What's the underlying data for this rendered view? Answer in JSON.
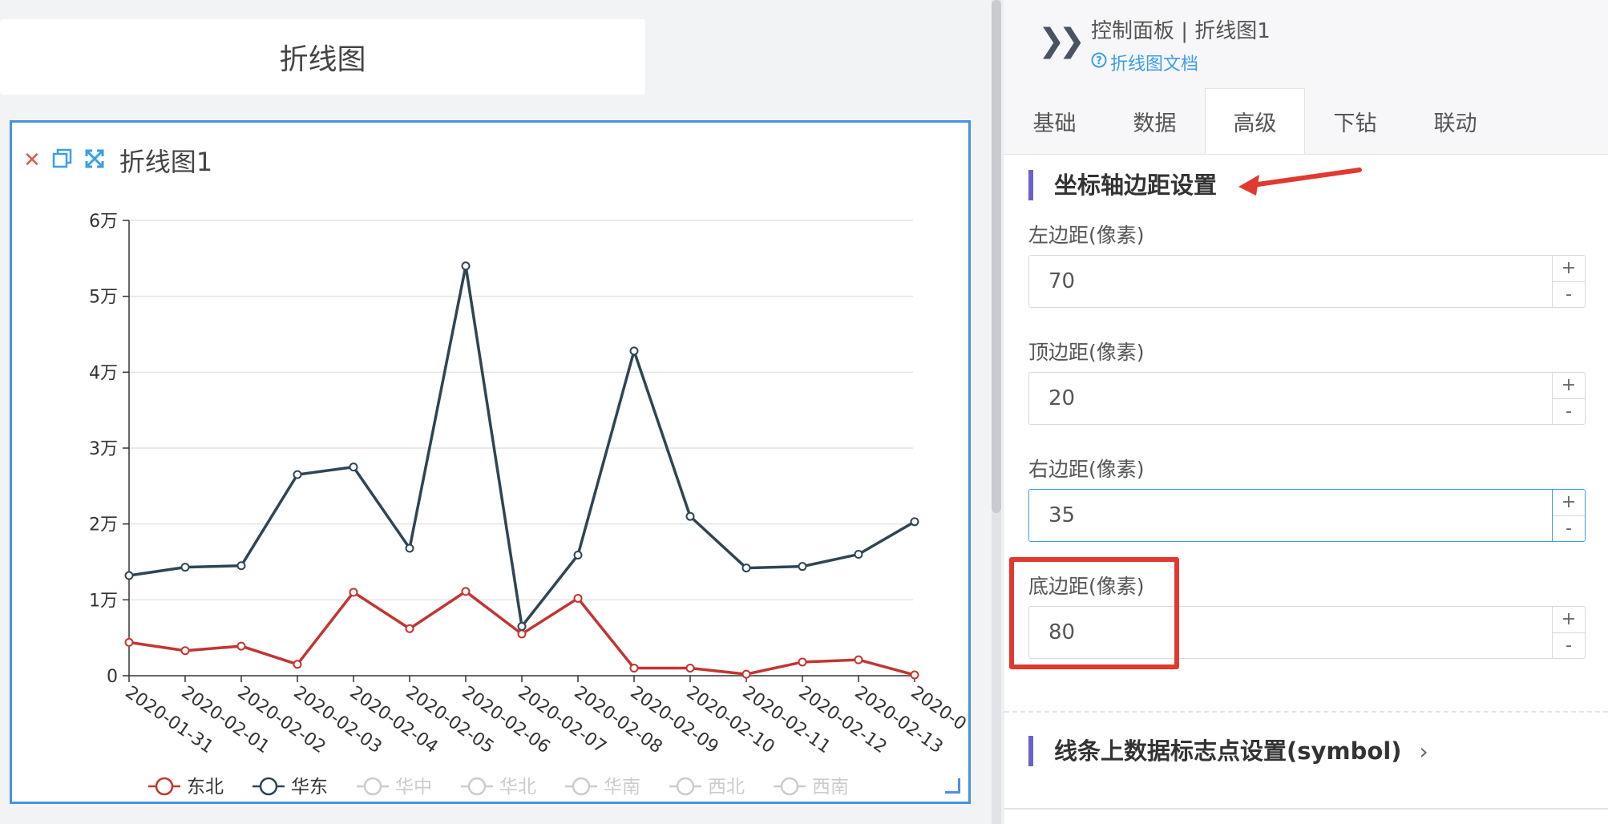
{
  "canvas_title": "折线图",
  "widget": {
    "title": "折线图1",
    "icons": [
      "close-icon",
      "copy-icon",
      "fullscreen-icon"
    ]
  },
  "chart_data": {
    "type": "line",
    "categories": [
      "2020-01-31",
      "2020-02-01",
      "2020-02-02",
      "2020-02-03",
      "2020-02-04",
      "2020-02-05",
      "2020-02-06",
      "2020-02-07",
      "2020-02-08",
      "2020-02-09",
      "2020-02-10",
      "2020-02-11",
      "2020-02-12",
      "2020-02-13",
      "2020-0"
    ],
    "y_ticks": [
      "0",
      "1万",
      "2万",
      "3万",
      "4万",
      "5万",
      "6万"
    ],
    "ylim": [
      0,
      60000
    ],
    "grid": true,
    "legend_position": "bottom",
    "series": [
      {
        "name": "东北",
        "color": "#c23531",
        "visible": true,
        "values": [
          4400,
          3300,
          3900,
          1500,
          11000,
          6200,
          11100,
          5500,
          10200,
          1000,
          1000,
          200,
          1800,
          2100,
          100
        ]
      },
      {
        "name": "华东",
        "color": "#2f4554",
        "visible": true,
        "values": [
          13200,
          14300,
          14500,
          26500,
          27500,
          16800,
          54000,
          6500,
          15900,
          42800,
          21000,
          14200,
          14400,
          16000,
          20300
        ]
      },
      {
        "name": "华中",
        "visible": false
      },
      {
        "name": "华北",
        "visible": false
      },
      {
        "name": "华南",
        "visible": false
      },
      {
        "name": "西北",
        "visible": false
      },
      {
        "name": "西南",
        "visible": false
      }
    ]
  },
  "panel": {
    "title": "控制面板 | 折线图1",
    "doc_link": "折线图文档",
    "tabs": [
      "基础",
      "数据",
      "高级",
      "下钻",
      "联动"
    ],
    "active_tab": "高级",
    "section_title": "坐标轴边距设置",
    "fields": [
      {
        "label": "左边距(像素)",
        "value": "70"
      },
      {
        "label": "顶边距(像素)",
        "value": "20"
      },
      {
        "label": "右边距(像素)",
        "value": "35"
      },
      {
        "label": "底边距(像素)",
        "value": "80"
      }
    ],
    "spin_plus": "+",
    "spin_minus": "-",
    "section2_title": "线条上数据标志点设置(symbol)",
    "colors": {
      "accent": "#3c9ee5",
      "section_bar": "#6b62c9",
      "annotation": "#e03a30"
    }
  }
}
